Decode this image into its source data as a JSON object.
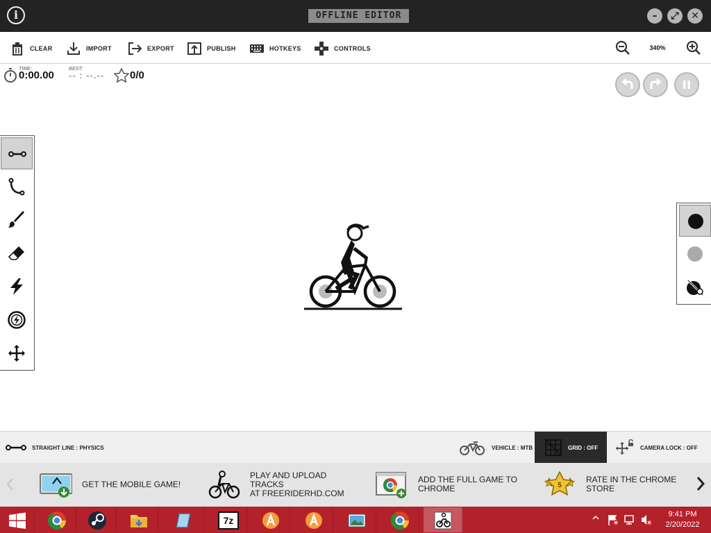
{
  "window": {
    "title": "OFFLINE EDITOR",
    "info_label": "i",
    "minimize_label": "–",
    "maximize_label": "⤢",
    "close_label": "✕"
  },
  "toolbar": {
    "clear": "CLEAR",
    "import": "IMPORT",
    "export": "EXPORT",
    "publish": "PUBLISH",
    "hotkeys": "HOTKEYS",
    "controls": "CONTROLS",
    "zoom": "340%"
  },
  "timers": {
    "time_label": "TIME:",
    "time_value": "0:00.00",
    "best_label": "BEST:",
    "best_value": "-- : --.--",
    "stars_value": "0/0"
  },
  "tools": [
    {
      "name": "straight-line",
      "icon": "line-tool-icon",
      "active": true
    },
    {
      "name": "curve",
      "icon": "curve-tool-icon",
      "active": false
    },
    {
      "name": "brush",
      "icon": "brush-tool-icon",
      "active": false
    },
    {
      "name": "eraser",
      "icon": "eraser-tool-icon",
      "active": false
    },
    {
      "name": "powerups",
      "icon": "lightning-icon",
      "active": false
    },
    {
      "name": "special",
      "icon": "powerup-circle-icon",
      "active": false
    },
    {
      "name": "camera",
      "icon": "move-icon",
      "active": false
    }
  ],
  "colors": {
    "physics": "#111111",
    "scenery": "#aaaaaa",
    "title_bar": "#232323",
    "taskbar": "#b3212b"
  },
  "status": {
    "tool_label": "STRAIGHT LINE : PHYSICS",
    "vehicle_label": "VEHICLE : MTB",
    "grid_label": "GRID : OFF",
    "camera_label": "CAMERA LOCK : OFF"
  },
  "promo": [
    {
      "text": "GET THE MOBILE GAME!"
    },
    {
      "text": "PLAY AND UPLOAD TRACKS\nAT FREERIDERHD.COM"
    },
    {
      "text": "ADD THE FULL GAME TO\nCHROME"
    },
    {
      "text": "RATE IN THE CHROME\nSTORE"
    }
  ],
  "promo_badge": "5",
  "taskbar": {
    "time": "9:41 PM",
    "date": "2/20/2022",
    "sevenzip_label": "7z"
  }
}
